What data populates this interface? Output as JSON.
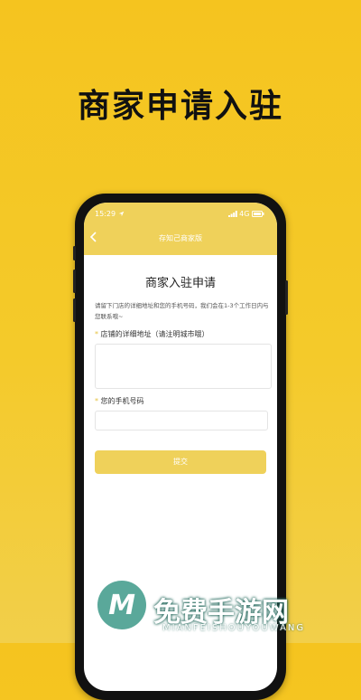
{
  "headline": "商家申请入驻",
  "status_bar": {
    "time": "15:29",
    "network": "4G"
  },
  "nav": {
    "title": "存知己商家版"
  },
  "form": {
    "title": "商家入驻申请",
    "description": "请留下门店的详细地址和您的手机号码，我们会在1-3个工作日内与您联系哦~",
    "address": {
      "label": "店铺的详细地址（请注明城市哦）",
      "value": ""
    },
    "phone": {
      "label": "您的手机号码",
      "value": ""
    },
    "submit_label": "提交"
  },
  "watermark": {
    "title": "免费手游网",
    "subtitle": "MIANFEISHOUYOUWANG"
  },
  "colors": {
    "background": "#f5c41f",
    "accent": "#efd15a",
    "required": "#e6c240"
  },
  "icons": {
    "back": "chevron-left-icon",
    "location": "location-arrow-icon",
    "signal": "signal-icon",
    "battery": "battery-icon"
  }
}
